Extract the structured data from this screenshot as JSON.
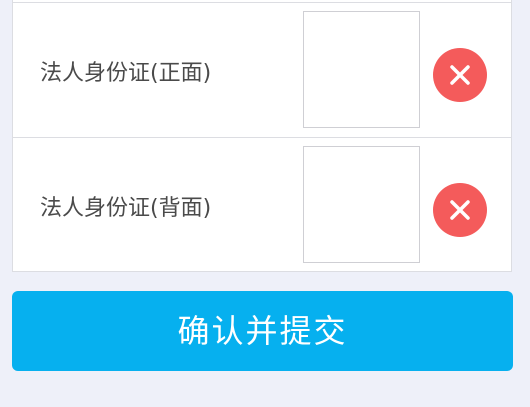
{
  "upload_rows": [
    {
      "label": "法人身份证(正面)",
      "delete_icon": "close-icon",
      "delete_color": "#f45b5b"
    },
    {
      "label": "法人身份证(背面)",
      "delete_icon": "close-icon",
      "delete_color": "#f45b5b"
    }
  ],
  "submit": {
    "label": "确认并提交",
    "color": "#06b0ef"
  }
}
